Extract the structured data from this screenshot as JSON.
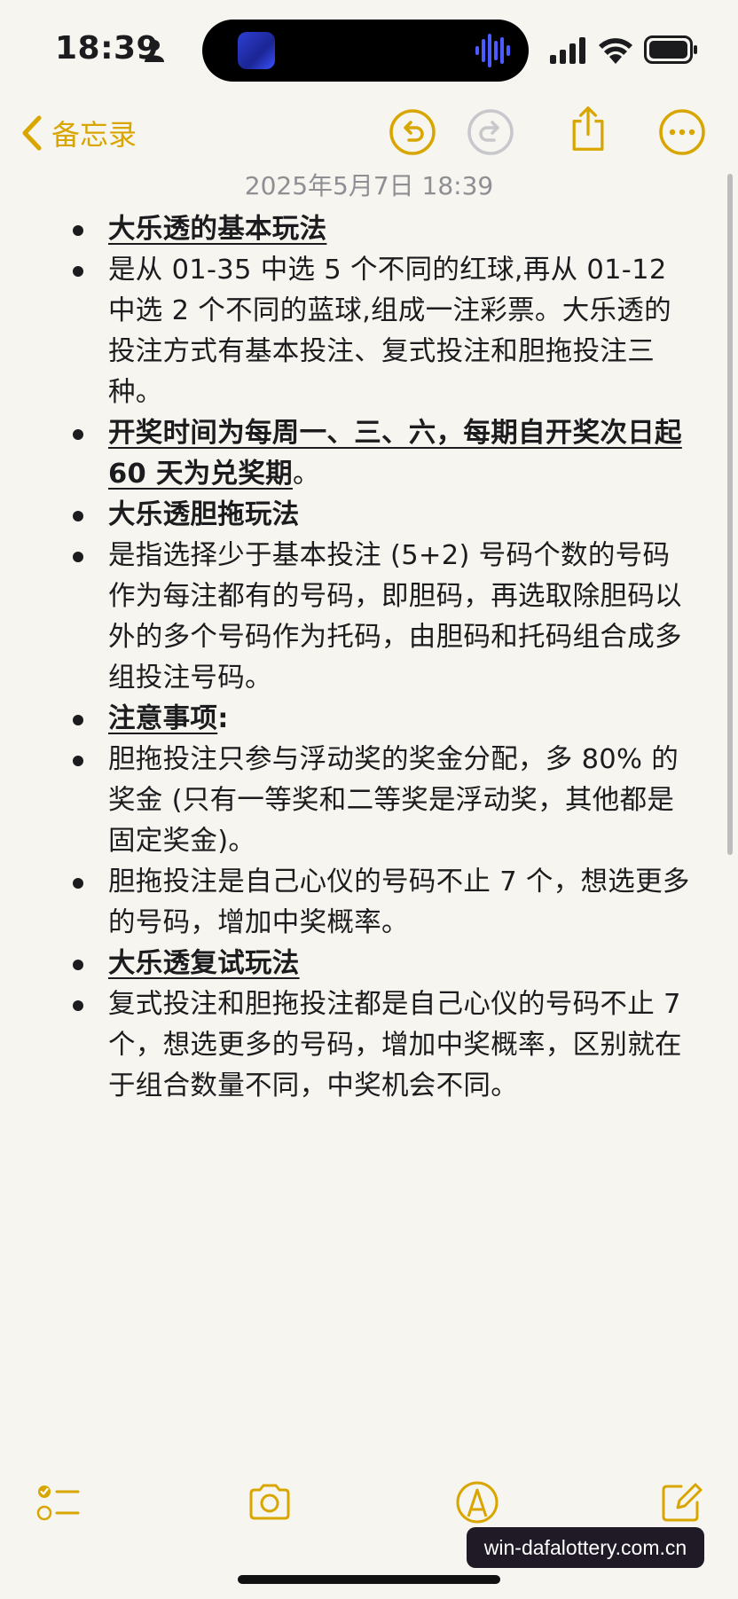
{
  "status_bar": {
    "time": "18:39"
  },
  "nav": {
    "back_label": "备忘录"
  },
  "note": {
    "date": "2025年5月7日 18:39",
    "items": [
      {
        "header": "大乐透的基本玩法"
      },
      {
        "text": "是从 01-35 中选 5 个不同的红球,再从 01-12 中选 2 个不同的蓝球,组成一注彩票。大乐透的投注方式有基本投注、复式投注和胆拖投注三种。"
      },
      {
        "header": "开奖时间为每周一、三、六，每期自开奖次日起 60 天为兑奖期",
        "suffix": "。"
      },
      {
        "text": "大乐透胆拖玩法"
      },
      {
        "text": "是指选择少于基本投注 (5+2) 号码个数的号码作为每注都有的号码，即胆码，再选取除胆码以外的多个号码作为托码，由胆码和托码组合成多组投注号码。"
      },
      {
        "header": "注意事项",
        "suffix": ":"
      },
      {
        "text": "胆拖投注只参与浮动奖的奖金分配，多 80% 的奖金 (只有一等奖和二等奖是浮动奖，其他都是固定奖金)。"
      },
      {
        "text": "胆拖投注是自己心仪的号码不止 7 个，想选更多的号码，增加中奖概率。"
      },
      {
        "header": "大乐透复试玩法"
      },
      {
        "text": "复式投注和胆拖投注都是自己心仪的号码不止 7 个，想选更多的号码，增加中奖概率，区别就在于组合数量不同，中奖机会不同。"
      }
    ]
  },
  "watermark": "win-dafalottery.com.cn",
  "colors": {
    "accent": "#d9a600",
    "background": "#f6f5f0",
    "text": "#1c1c1e",
    "date": "#8e8e93"
  },
  "icons": {
    "nav": [
      "chevron-left-icon",
      "undo-icon",
      "redo-icon",
      "share-icon",
      "more-icon"
    ],
    "toolbar": [
      "checklist-icon",
      "camera-icon",
      "markup-icon",
      "compose-icon"
    ]
  }
}
